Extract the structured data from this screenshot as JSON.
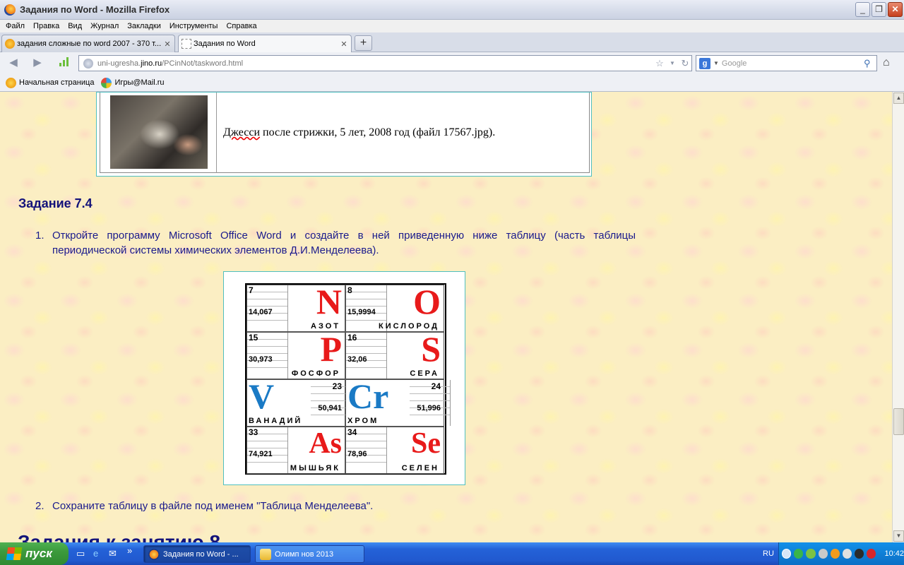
{
  "window": {
    "title": "Задания по Word - Mozilla Firefox",
    "min": "_",
    "max": "❐",
    "close": "✕"
  },
  "menu": [
    "Файл",
    "Правка",
    "Вид",
    "Журнал",
    "Закладки",
    "Инструменты",
    "Справка"
  ],
  "tabs": [
    {
      "label": "задания сложные по word 2007 - 370 т...",
      "close": "✕"
    },
    {
      "label": "Задания по Word",
      "close": "✕"
    }
  ],
  "newtab": "+",
  "nav": {
    "back": "◀",
    "forward": "▶",
    "url_host": "uni-ugresha.",
    "url_bold": "jino.ru",
    "url_rest": "/PCinNot/taskword.html",
    "star": "☆",
    "drop": "▼",
    "reload": "↻",
    "search_engine": "g",
    "search_placeholder": "Google",
    "search_go": "⚲",
    "home": "⌂"
  },
  "bookmarks": [
    "Начальная страница",
    "Игры@Mail.ru"
  ],
  "page": {
    "photo_caption_word": "Джесси",
    "photo_caption_rest": " после стрижки, 5 лет, 2008 год (файл 17567.jpg).",
    "task_title": "Задание 7.4",
    "step1_num": "1.",
    "step1_text": "Откройте программу Microsoft Office Word и создайте в ней приведенную ниже таблицу (часть таблицы периодической системы химических элементов Д.И.Менделеева).",
    "step2_num": "2.",
    "step2_text": "Сохраните таблицу в файле под именем \"Таблица Менделеева\".",
    "next_heading": "Задания к занятию 8"
  },
  "elements": [
    {
      "num": "7",
      "mass": "14,067",
      "symbol": "N",
      "name": "АЗОТ",
      "color": "#e81a1a"
    },
    {
      "num": "8",
      "mass": "15,9994",
      "symbol": "O",
      "name": "КИСЛОРОД",
      "color": "#e81a1a"
    },
    {
      "num": "15",
      "mass": "30,973",
      "symbol": "P",
      "name": "ФОСФОР",
      "color": "#e81a1a"
    },
    {
      "num": "16",
      "mass": "32,06",
      "symbol": "S",
      "name": "СЕРА",
      "color": "#e81a1a"
    },
    {
      "num": "23",
      "mass": "50,941",
      "symbol": "V",
      "name": "ВАНАДИЙ",
      "color": "#1a7ac5"
    },
    {
      "num": "24",
      "mass": "51,996",
      "symbol": "Cr",
      "name": "ХРОМ",
      "color": "#1a7ac5"
    },
    {
      "num": "33",
      "mass": "74,921",
      "symbol": "As",
      "name": "МЫШЬЯК",
      "color": "#e81a1a"
    },
    {
      "num": "34",
      "mass": "78,96",
      "symbol": "Se",
      "name": "СЕЛЕН",
      "color": "#e81a1a"
    }
  ],
  "taskbar": {
    "start": "пуск",
    "quick": [
      "»"
    ],
    "tasks": [
      "Задания по Word - ...",
      "Олимп нов 2013"
    ],
    "lang": "RU",
    "clock": "10:42"
  }
}
